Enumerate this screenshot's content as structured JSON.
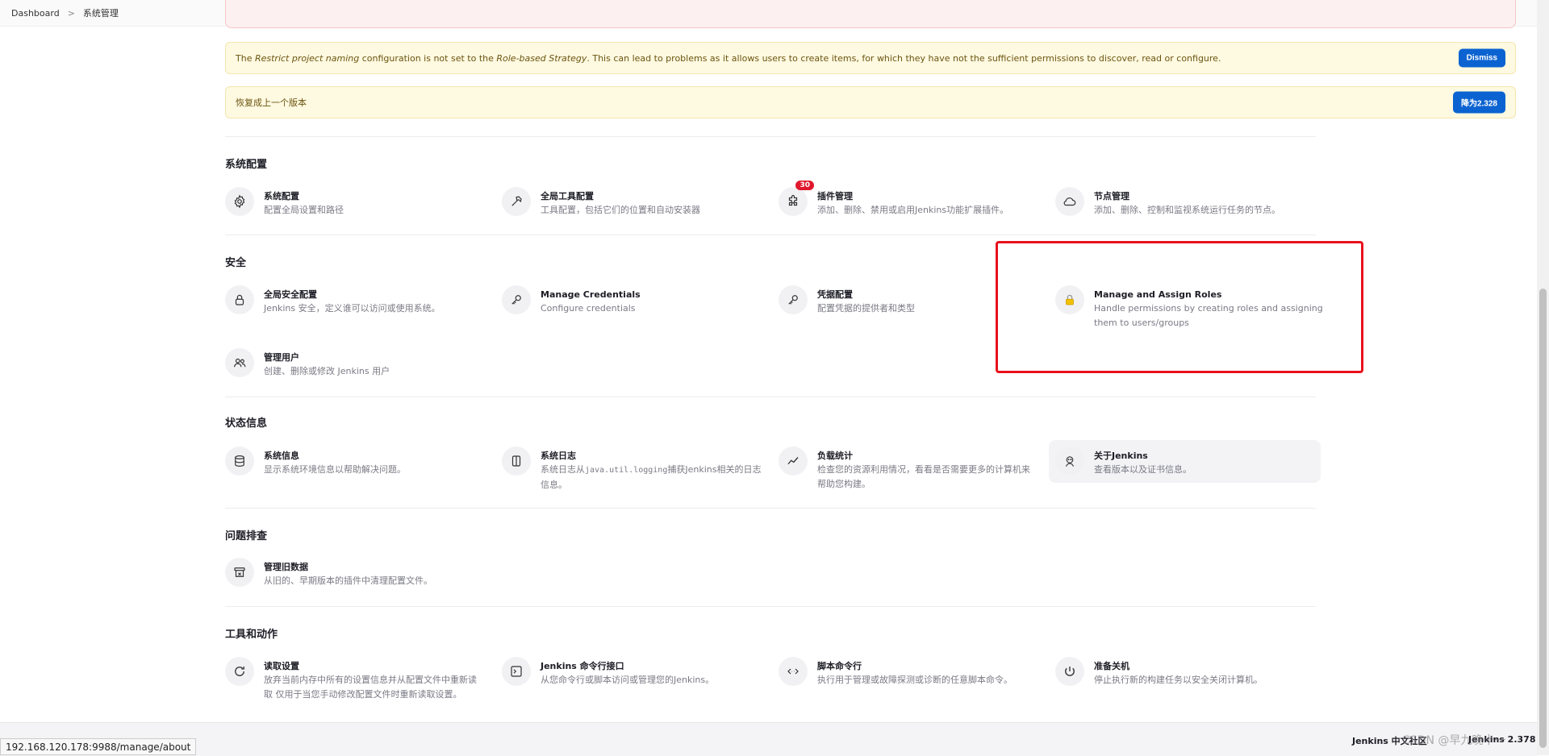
{
  "breadcrumb": {
    "home": "Dashboard",
    "current": "系统管理"
  },
  "alerts": {
    "restrict": {
      "part1": "The ",
      "em1": "Restrict project naming",
      "part2": " configuration is not set to the ",
      "em2": "Role-based Strategy",
      "part3": ". This can lead to problems as it allows users to create items, for which they have not the sufficient permissions to discover, read or configure.",
      "button": "Dismiss"
    },
    "downgrade": {
      "text": "恢复成上一个版本",
      "button": "降为2.328"
    }
  },
  "sections": {
    "config": {
      "title": "系统配置",
      "items": [
        {
          "name": "系统配置",
          "desc": "配置全局设置和路径",
          "icon": "gear-icon"
        },
        {
          "name": "全局工具配置",
          "desc": "工具配置，包括它们的位置和自动安装器",
          "icon": "hammer-icon"
        },
        {
          "name": "插件管理",
          "desc": "添加、删除、禁用或启用Jenkins功能扩展插件。",
          "icon": "puzzle-icon",
          "badge": "30"
        },
        {
          "name": "节点管理",
          "desc": "添加、删除、控制和监视系统运行任务的节点。",
          "icon": "cloud-icon"
        }
      ]
    },
    "security": {
      "title": "安全",
      "items": [
        {
          "name": "全局安全配置",
          "desc": "Jenkins 安全，定义谁可以访问或使用系统。",
          "icon": "lock-icon"
        },
        {
          "name": "Manage Credentials",
          "desc": "Configure credentials",
          "icon": "key-icon"
        },
        {
          "name": "凭据配置",
          "desc": "配置凭据的提供者和类型",
          "icon": "key-icon"
        },
        {
          "name": "Manage and Assign Roles",
          "desc1": "Handle permissions by creating roles and assigning",
          "desc2": "them to users/groups",
          "icon": "padlock-yellow-icon"
        },
        {
          "name": "管理用户",
          "desc": "创建、删除或修改 Jenkins 用户",
          "icon": "users-icon"
        }
      ]
    },
    "status": {
      "title": "状态信息",
      "items": [
        {
          "name": "系统信息",
          "desc": "显示系统环境信息以帮助解决问题。",
          "icon": "database-icon"
        },
        {
          "name": "系统日志",
          "desc_pre": "系统日志从",
          "desc_code": "java.util.logging",
          "desc_post": "捕获Jenkins相关的日志",
          "desc2": "信息。",
          "icon": "log-icon"
        },
        {
          "name": "负载统计",
          "desc1": "检查您的资源利用情况，看看是否需要更多的计算机来",
          "desc2": "帮助您构建。",
          "icon": "chart-icon"
        },
        {
          "name": "关于Jenkins",
          "desc": "查看版本以及证书信息。",
          "icon": "jenkins-icon"
        }
      ]
    },
    "trouble": {
      "title": "问题排查",
      "items": [
        {
          "name": "管理旧数据",
          "desc": "从旧的、早期版本的插件中清理配置文件。",
          "icon": "archive-icon"
        }
      ]
    },
    "tools": {
      "title": "工具和动作",
      "items": [
        {
          "name": "读取设置",
          "desc1": "放弃当前内存中所有的设置信息并从配置文件中重新读",
          "desc2": "取 仅用于当您手动修改配置文件时重新读取设置。",
          "icon": "reload-icon"
        },
        {
          "name": "Jenkins 命令行接口",
          "desc": "从您命令行或脚本访问或管理您的Jenkins。",
          "icon": "terminal-icon"
        },
        {
          "name": "脚本命令行",
          "desc": "执行用于管理或故障探测或诊断的任意脚本命令。",
          "icon": "code-icon"
        },
        {
          "name": "准备关机",
          "desc": "停止执行新的构建任务以安全关闭计算机。",
          "icon": "power-icon"
        }
      ]
    }
  },
  "footer": {
    "community": "Jenkins 中文社区",
    "version": "Jenkins 2.378"
  },
  "status_url": "192.168.120.178:9988/manage/about",
  "watermark": "CSDN @早九晚十一"
}
